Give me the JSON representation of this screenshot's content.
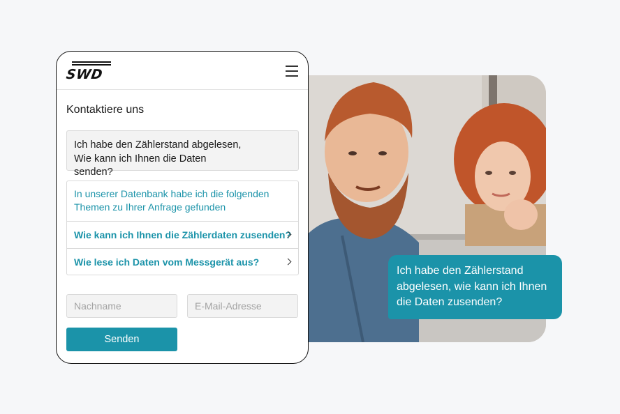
{
  "brand": {
    "logo_text": "SWD"
  },
  "form": {
    "title": "Kontaktiere uns",
    "question_lines": [
      "Ich habe den Zählerstand abgelesen,",
      "Wie kann ich Ihnen die Daten",
      "senden?"
    ],
    "answers": {
      "intro_lines": [
        "In unserer Datenbank habe ich die folgenden",
        "Themen zu Ihrer Anfrage gefunden"
      ],
      "items": [
        {
          "label": "Wie kann ich Ihnen die Zählerdaten zusenden?",
          "icon": "chevron-right-icon"
        },
        {
          "label": "Wie lese ich Daten vom Messgerät aus?",
          "icon": "chevron-right-icon"
        }
      ]
    },
    "lastname_placeholder": "Nachname",
    "email_placeholder": "E-Mail-Adresse",
    "submit_label": "Senden"
  },
  "bubble": {
    "lines": [
      "Ich habe den Zählerstand",
      "abgelesen, wie kann ich Ihnen",
      "die Daten zusenden?"
    ]
  },
  "colors": {
    "accent": "#1b93a9",
    "background": "#f6f7f9",
    "field_background": "#f3f3f3"
  }
}
